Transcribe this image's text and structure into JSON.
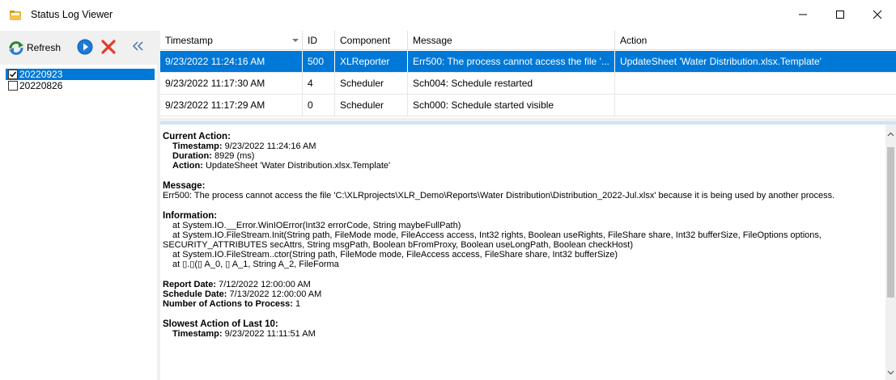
{
  "window": {
    "title": "Status Log Viewer"
  },
  "toolbar": {
    "refresh_label": "Refresh"
  },
  "dates": [
    {
      "label": "20220923",
      "checked": true,
      "selected": true
    },
    {
      "label": "20220826",
      "checked": false,
      "selected": false
    }
  ],
  "grid": {
    "columns": [
      "Timestamp",
      "ID",
      "Component",
      "Message",
      "Action"
    ],
    "rows": [
      {
        "timestamp": "9/23/2022 11:24:16 AM",
        "id": "500",
        "component": "XLReporter",
        "message": "Err500: The process cannot access the file '...",
        "action": "UpdateSheet 'Water Distribution.xlsx.Template'"
      },
      {
        "timestamp": "9/23/2022 11:17:30 AM",
        "id": "4",
        "component": "Scheduler",
        "message": "Sch004: Schedule restarted",
        "action": ""
      },
      {
        "timestamp": "9/23/2022 11:17:29 AM",
        "id": "0",
        "component": "Scheduler",
        "message": "Sch000: Schedule started visible",
        "action": ""
      }
    ]
  },
  "detail": {
    "current_action_title": "Current Action:",
    "timestamp_label": "Timestamp:",
    "timestamp_value": "9/23/2022 11:24:16 AM",
    "duration_label": "Duration:",
    "duration_value": "8929 (ms)",
    "action_label": "Action:",
    "action_value": "UpdateSheet 'Water Distribution.xlsx.Template'",
    "message_title": "Message:",
    "message_text": "Err500: The process cannot access the file 'C:\\XLRprojects\\XLR_Demo\\Reports\\Water Distribution\\Distribution_2022-Jul.xlsx' because it is being used by another process.",
    "information_title": "Information:",
    "info_lines": [
      "at System.IO.__Error.WinIOError(Int32 errorCode, String maybeFullPath)",
      "at System.IO.FileStream.Init(String path, FileMode mode, FileAccess access, Int32 rights, Boolean useRights, FileShare share, Int32 bufferSize, FileOptions options,",
      "SECURITY_ATTRIBUTES secAttrs, String msgPath, Boolean bFromProxy, Boolean useLongPath, Boolean checkHost)",
      "at System.IO.FileStream..ctor(String path, FileMode mode, FileAccess access, FileShare share, Int32 bufferSize)",
      "at ▯.▯(▯ A_0, ▯ A_1, String A_2, FileForma"
    ],
    "report_date_label": "Report Date:",
    "report_date_value": "7/12/2022 12:00:00 AM",
    "schedule_date_label": "Schedule Date:",
    "schedule_date_value": "7/13/2022 12:00:00 AM",
    "num_actions_label": "Number of Actions to Process:",
    "num_actions_value": "1",
    "slowest_title": "Slowest Action of Last 10:",
    "slowest_timestamp_label": "Timestamp:",
    "slowest_timestamp_value": "9/23/2022 11:11:51 AM"
  },
  "colors": {
    "selection": "#0078d7",
    "panel": "#f0f0f0"
  }
}
